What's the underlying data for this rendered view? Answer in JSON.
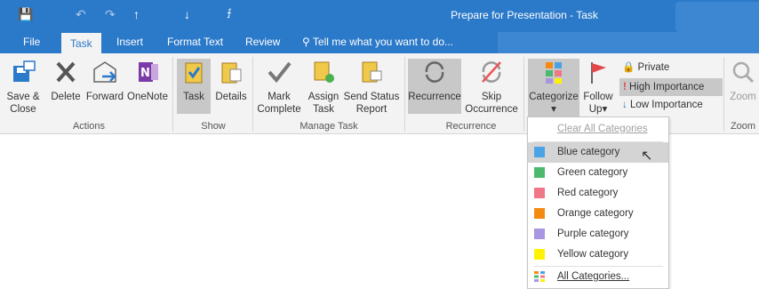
{
  "window": {
    "title": "Prepare for Presentation - Task"
  },
  "qat": {
    "save": "💾",
    "undo": "↶",
    "redo": "↷",
    "up": "↑",
    "down": "↓",
    "more": "⨍"
  },
  "tabs": [
    "File",
    "Task",
    "Insert",
    "Format Text",
    "Review"
  ],
  "tell_me": "Tell me what you want to do...",
  "ribbon": {
    "actions": {
      "save_close_1": "Save &",
      "save_close_2": "Close",
      "delete": "Delete",
      "forward": "Forward",
      "onenote": "OneNote",
      "group": "Actions"
    },
    "show": {
      "task": "Task",
      "details": "Details",
      "group": "Show"
    },
    "manage": {
      "mark_1": "Mark",
      "mark_2": "Complete",
      "assign_1": "Assign",
      "assign_2": "Task",
      "send_1": "Send Status",
      "send_2": "Report",
      "group": "Manage Task"
    },
    "recurrence": {
      "recurrence": "Recurrence",
      "skip_1": "Skip",
      "skip_2": "Occurrence",
      "group": "Recurrence"
    },
    "tags": {
      "categorize": "Categorize",
      "follow_1": "Follow",
      "follow_2": "Up",
      "private": "Private",
      "high": "High Importance",
      "low": "Low Importance"
    },
    "zoom": {
      "zoom": "Zoom",
      "group": "Zoom"
    }
  },
  "menu": {
    "clear": "Clear All Categories",
    "items": [
      {
        "label": "Blue category",
        "color": "#4aa3e6"
      },
      {
        "label": "Green category",
        "color": "#4cba6e"
      },
      {
        "label": "Red category",
        "color": "#f07787"
      },
      {
        "label": "Orange category",
        "color": "#f58a12"
      },
      {
        "label": "Purple category",
        "color": "#a896e0"
      },
      {
        "label": "Yellow category",
        "color": "#fff200"
      }
    ],
    "all": "All Categories..."
  }
}
